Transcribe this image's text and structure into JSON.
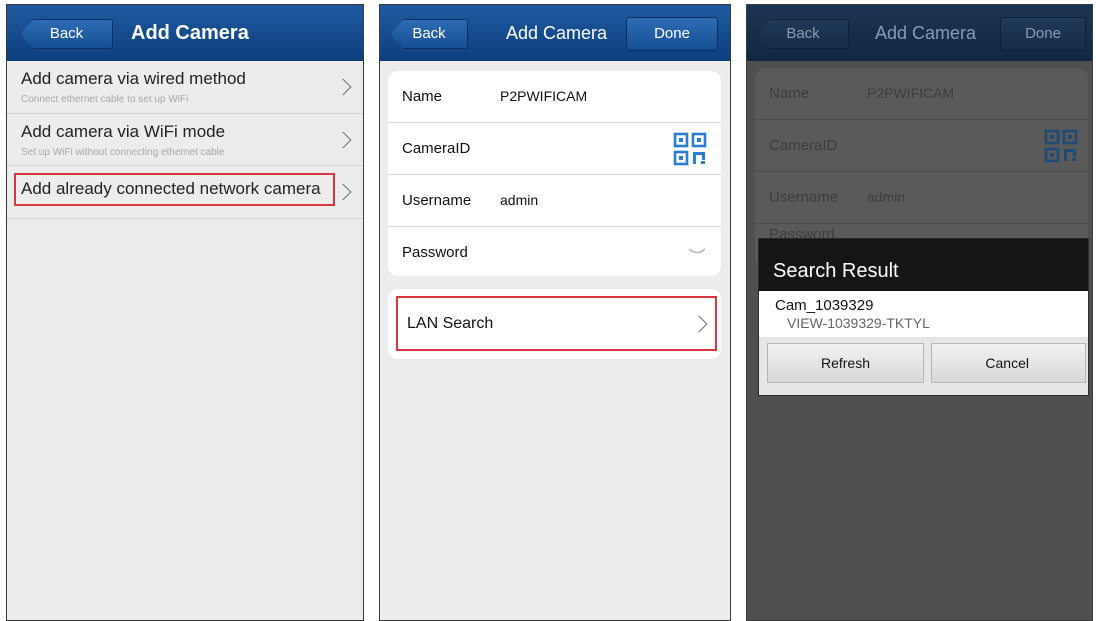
{
  "screen1": {
    "nav": {
      "back": "Back",
      "title": "Add Camera"
    },
    "items": [
      {
        "title": "Add camera via wired method",
        "subtitle": "Connect ethernet cable to set up WiFi"
      },
      {
        "title": "Add camera via WiFi mode",
        "subtitle": "Set up WiFi without connecting ethernet cable"
      },
      {
        "title": "Add already connected network camera",
        "subtitle": ""
      }
    ]
  },
  "screen2": {
    "nav": {
      "back": "Back",
      "title": "Add Camera",
      "done": "Done"
    },
    "fields": {
      "name_label": "Name",
      "name_value": "P2PWIFICAM",
      "cameraid_label": "CameraID",
      "username_label": "Username",
      "username_value": "admin",
      "password_label": "Password"
    },
    "lan_search": "LAN Search"
  },
  "screen3": {
    "nav": {
      "back": "Back",
      "title": "Add Camera",
      "done": "Done"
    },
    "fields": {
      "name_label": "Name",
      "name_value": "P2PWIFICAM",
      "cameraid_label": "CameraID",
      "username_label": "Username",
      "username_value": "admin",
      "password_label": "Password"
    },
    "dialog": {
      "title": "Search Result",
      "result_name": "Cam_1039329",
      "result_id": "VIEW-1039329-TKTYL",
      "refresh": "Refresh",
      "cancel": "Cancel"
    }
  },
  "colors": {
    "nav_bar": "#1a4f92",
    "highlight": "#d9363e",
    "dialog_header": "#151515"
  },
  "icons": [
    "chevron-right-icon",
    "qr-code-icon",
    "eye-closed-icon"
  ]
}
